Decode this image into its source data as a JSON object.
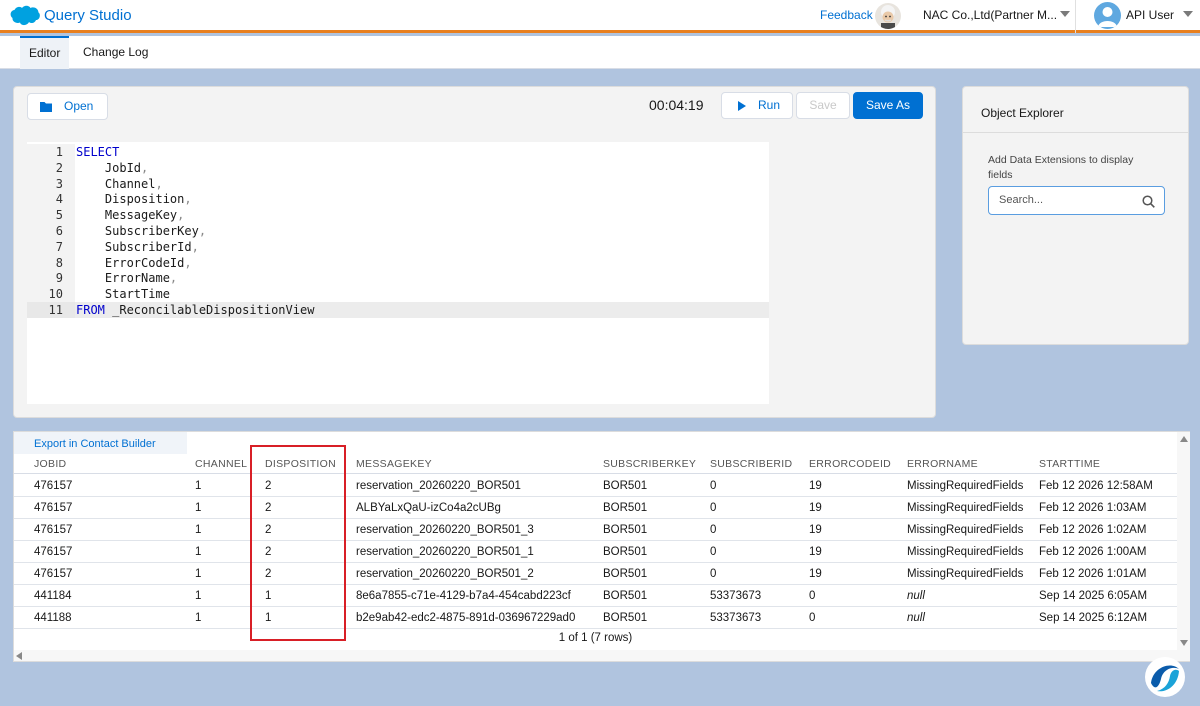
{
  "header": {
    "app_title": "Query Studio",
    "feedback_label": "Feedback",
    "org_name": "NAC Co.,Ltd(Partner M...",
    "user_name": "API User"
  },
  "tabs": [
    {
      "label": "Editor",
      "active": true
    },
    {
      "label": "Change Log",
      "active": false
    }
  ],
  "editor": {
    "open_label": "Open",
    "timer": "00:04:19",
    "run_label": "Run",
    "save_label": "Save",
    "save_as_label": "Save As",
    "code_lines": [
      {
        "num": "1",
        "keyword": "SELECT",
        "ident": "",
        "punct": ""
      },
      {
        "num": "2",
        "keyword": "",
        "ident": "    JobId",
        "punct": ","
      },
      {
        "num": "3",
        "keyword": "",
        "ident": "    Channel",
        "punct": ","
      },
      {
        "num": "4",
        "keyword": "",
        "ident": "    Disposition",
        "punct": ","
      },
      {
        "num": "5",
        "keyword": "",
        "ident": "    MessageKey",
        "punct": ","
      },
      {
        "num": "6",
        "keyword": "",
        "ident": "    SubscriberKey",
        "punct": ","
      },
      {
        "num": "7",
        "keyword": "",
        "ident": "    SubscriberId",
        "punct": ","
      },
      {
        "num": "8",
        "keyword": "",
        "ident": "    ErrorCodeId",
        "punct": ","
      },
      {
        "num": "9",
        "keyword": "",
        "ident": "    ErrorName",
        "punct": ","
      },
      {
        "num": "10",
        "keyword": "",
        "ident": "    StartTime",
        "punct": ""
      },
      {
        "num": "11",
        "keyword": "FROM",
        "ident": " _ReconcilableDispositionView",
        "punct": ""
      }
    ]
  },
  "object_explorer": {
    "title": "Object Explorer",
    "help_text": "Add Data Extensions to display fields",
    "search_placeholder": "Search..."
  },
  "results": {
    "export_label": "Export in Contact Builder",
    "columns": [
      "JOBID",
      "CHANNEL",
      "DISPOSITION",
      "MESSAGEKEY",
      "SUBSCRIBERKEY",
      "SUBSCRIBERID",
      "ERRORCODEID",
      "ERRORNAME",
      "STARTTIME"
    ],
    "rows": [
      [
        "476157",
        "1",
        "2",
        "reservation_20260220_BOR501",
        "BOR501",
        "0",
        "19",
        "MissingRequiredFields",
        "Feb 12 2026 12:58AM"
      ],
      [
        "476157",
        "1",
        "2",
        "ALBYaLxQaU-izCo4a2cUBg",
        "BOR501",
        "0",
        "19",
        "MissingRequiredFields",
        "Feb 12 2026 1:03AM"
      ],
      [
        "476157",
        "1",
        "2",
        "reservation_20260220_BOR501_3",
        "BOR501",
        "0",
        "19",
        "MissingRequiredFields",
        "Feb 12 2026 1:02AM"
      ],
      [
        "476157",
        "1",
        "2",
        "reservation_20260220_BOR501_1",
        "BOR501",
        "0",
        "19",
        "MissingRequiredFields",
        "Feb 12 2026 1:00AM"
      ],
      [
        "476157",
        "1",
        "2",
        "reservation_20260220_BOR501_2",
        "BOR501",
        "0",
        "19",
        "MissingRequiredFields",
        "Feb 12 2026 1:01AM"
      ],
      [
        "441184",
        "1",
        "1",
        "8e6a7855-c71e-4129-b7a4-454cabd223cf",
        "BOR501",
        "53373673",
        "0",
        "null",
        "Sep 14 2025 6:05AM"
      ],
      [
        "441188",
        "1",
        "1",
        "b2e9ab42-edc2-4875-891d-036967229ad0",
        "BOR501",
        "53373673",
        "0",
        "null",
        "Sep 14 2025 6:12AM"
      ]
    ],
    "pager": "1 of 1 (7 rows)"
  }
}
